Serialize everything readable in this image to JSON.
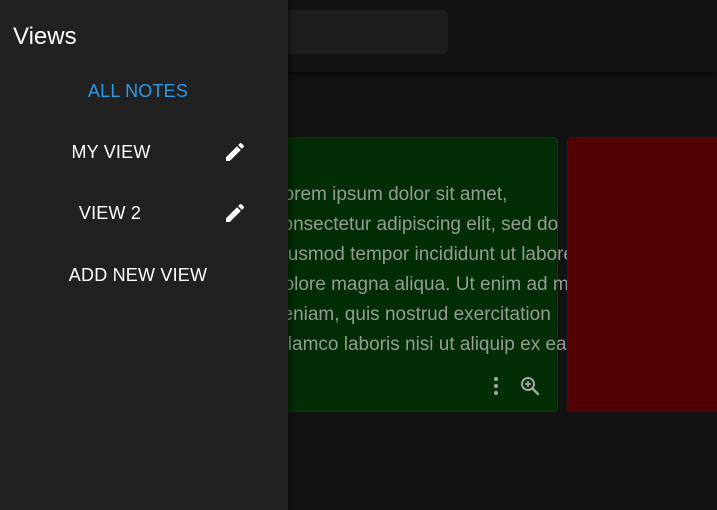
{
  "drawer": {
    "title": "Views",
    "items": [
      {
        "label": "ALL NOTES",
        "active": true
      },
      {
        "label": "MY VIEW",
        "editable": true
      },
      {
        "label": "VIEW 2",
        "editable": true
      },
      {
        "label": "ADD NEW VIEW"
      }
    ]
  },
  "notes": [
    {
      "color": "#022d05",
      "text_lines": [
        "Lorem ipsum dolor sit amet,",
        "consectetur adipiscing elit, sed do",
        "eiusmod tempor incididunt ut labore et",
        "dolore magna aliqua. Ut enim ad minim",
        "veniam, quis nostrud exercitation",
        "ullamco laboris nisi ut aliquip ex ea"
      ],
      "actions": [
        "more-vert-icon",
        "zoom-in-icon"
      ]
    },
    {
      "color": "#510104"
    }
  ],
  "colors": {
    "accent": "#2d9ae6",
    "drawer_bg": "#212121",
    "page_bg": "#121212"
  }
}
